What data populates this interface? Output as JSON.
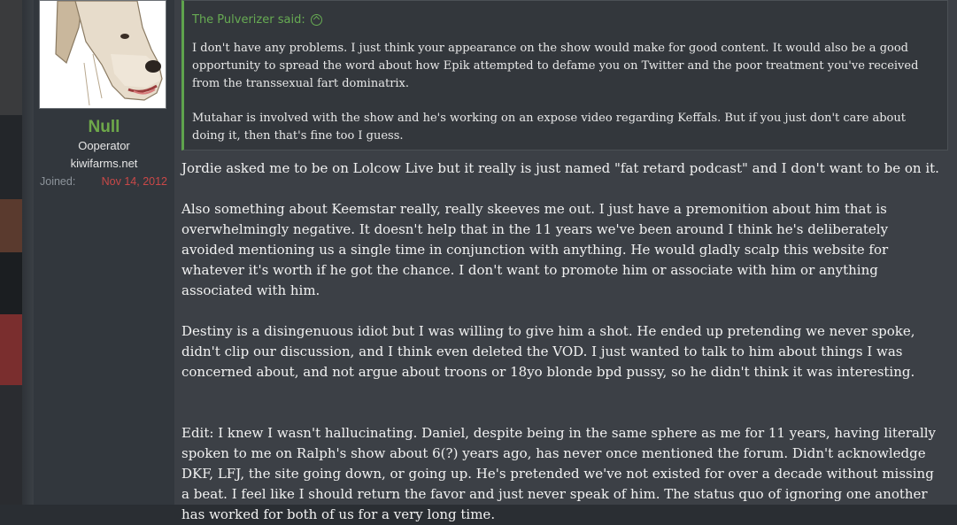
{
  "user": {
    "name": "Null",
    "title": "Ooperator",
    "banner": "kiwifarms.net",
    "joined_label": "Joined:",
    "joined_date": "Nov 14, 2012",
    "avatar_icon": "dog-avatar-icon"
  },
  "quote": {
    "author": "The Pulverizer said:",
    "paragraphs": [
      "I don't have any problems. I just think your appearance on the show would make for good content. It would also be a good opportunity to spread the word about how Epik attempted to defame you on Twitter and the poor treatment you've received from the transsexual fart dominatrix.",
      "Mutahar is involved with the show and he's working on an expose video regarding Keffals. But if you just don't care about doing it, then that's fine too I guess."
    ]
  },
  "post": {
    "paragraphs": [
      "Jordie asked me to be on Lolcow Live but it really is just named \"fat retard podcast\" and I don't want to be on it.",
      "Also something about Keemstar really, really skeeves me out. I just have a premonition about him that is overwhelmingly negative. It doesn't help that in the 11 years we've been around I think he's deliberately avoided mentioning us a single time in conjunction with anything. He would gladly scalp this website for whatever it's worth if he got the chance. I don't want to promote him or associate with him or anything associated with him.",
      "Destiny is a disingenuous idiot but I was willing to give him a shot. He ended up pretending we never spoke, didn't clip our discussion, and I think even deleted the VOD. I just wanted to talk to him about things I was concerned about, and not argue about troons or 18yo blonde bpd pussy, so he didn't think it was interesting.",
      "Edit: I knew I wasn't hallucinating. Daniel, despite being in the same sphere as me for 11 years, having literally spoken to me on Ralph's show about 6(?) years ago, has never once mentioned the forum. Didn't acknowledge DKF, LFJ, the site going down, or going up. He's pretended we've not existed for over a decade without missing a beat. I feel like I should return the favor and just never speak of him. The status quo of ignoring one another has worked for both of us for a very long time."
    ]
  },
  "colors": {
    "username": "#6ea84a",
    "quote_accent": "#5fa34d",
    "joined_date": "#c94848"
  }
}
